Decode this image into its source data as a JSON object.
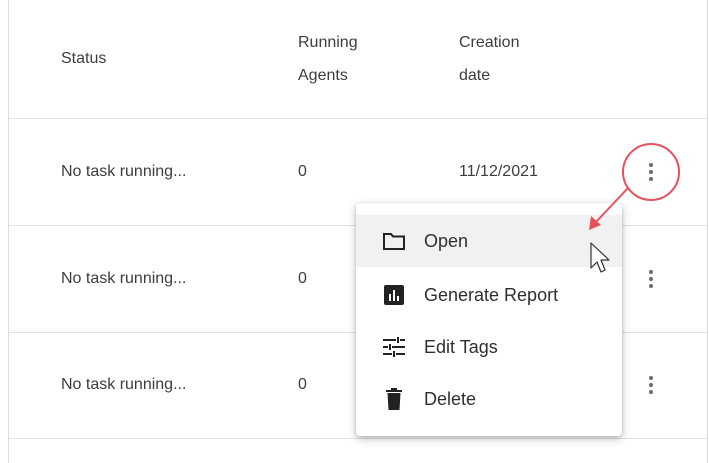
{
  "table": {
    "headers": {
      "status": "Status",
      "running_line1": "Running",
      "running_line2": "Agents",
      "creation_line1": "Creation",
      "creation_line2": "date"
    },
    "rows": [
      {
        "status": "No task running...",
        "agents": "0",
        "date": "11/12/2021"
      },
      {
        "status": "No task running...",
        "agents": "0",
        "date": ""
      },
      {
        "status": "No task running...",
        "agents": "0",
        "date": ""
      }
    ]
  },
  "menu": {
    "items": [
      {
        "label": "Open",
        "icon": "folder-icon"
      },
      {
        "label": "Generate Report",
        "icon": "report-icon"
      },
      {
        "label": "Edit Tags",
        "icon": "tune-icon"
      },
      {
        "label": "Delete",
        "icon": "trash-icon"
      }
    ]
  },
  "colors": {
    "annotation": "#e8505b",
    "highlight": "#f1f1f1"
  }
}
